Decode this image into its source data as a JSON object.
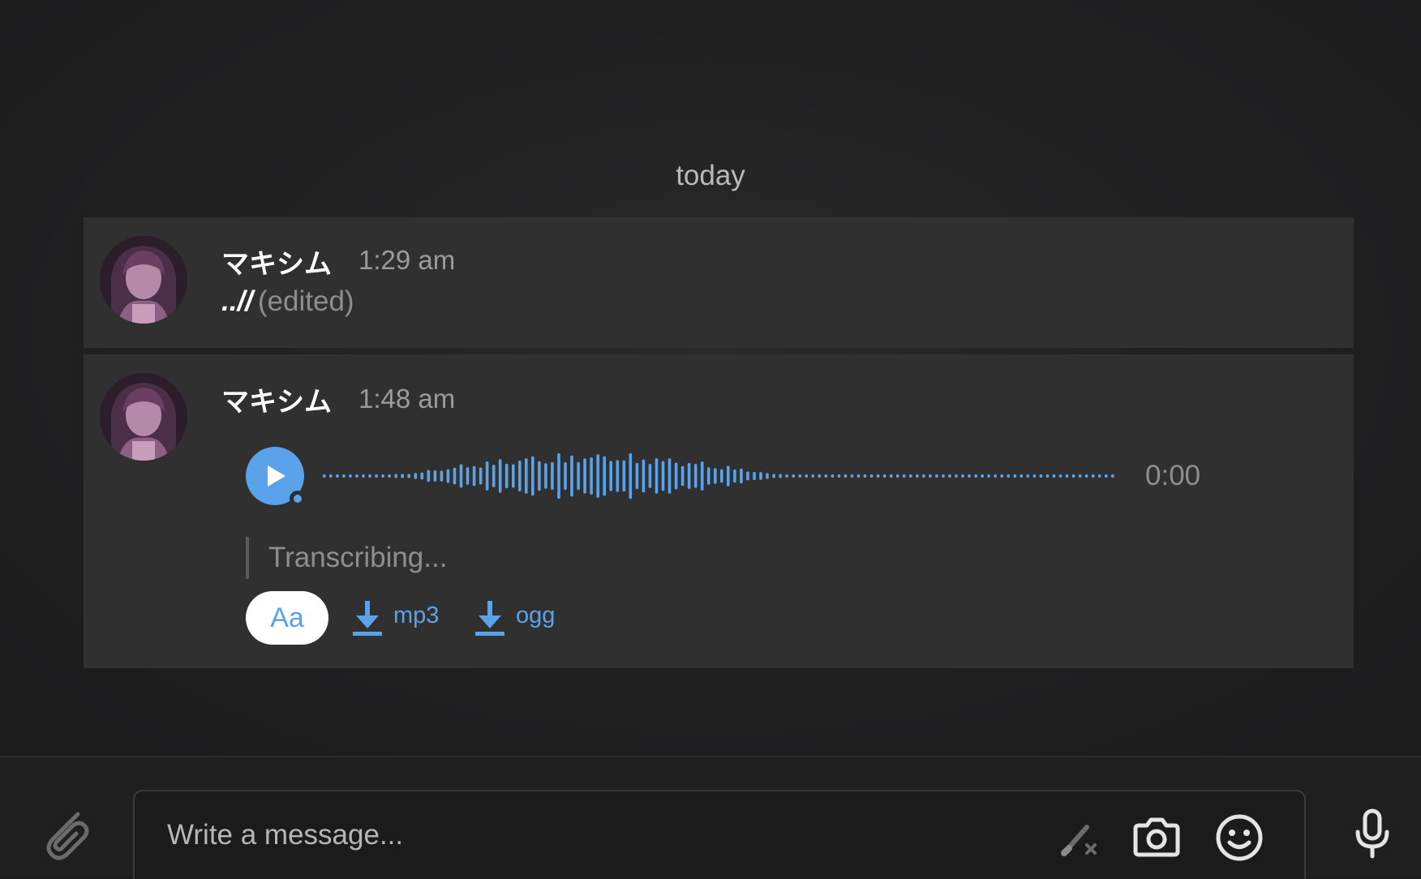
{
  "date_separator": "today",
  "messages": [
    {
      "author": "マキシム",
      "time": "1:29 am",
      "text": "..//",
      "edited_label": "(edited)"
    },
    {
      "author": "マキシム",
      "time": "1:48 am",
      "voice": {
        "duration": "0:00",
        "transcription_status": "Transcribing...",
        "play_icon": "play-icon",
        "accent_color": "#5aa2ea"
      },
      "actions": {
        "aa_label": "Aa",
        "download_mp3": "mp3",
        "download_ogg": "ogg"
      }
    }
  ],
  "composer": {
    "placeholder": "Write a message...",
    "icons": [
      "paperclip-icon",
      "clear-formatting-icon",
      "camera-icon",
      "emoji-icon",
      "microphone-icon"
    ]
  }
}
